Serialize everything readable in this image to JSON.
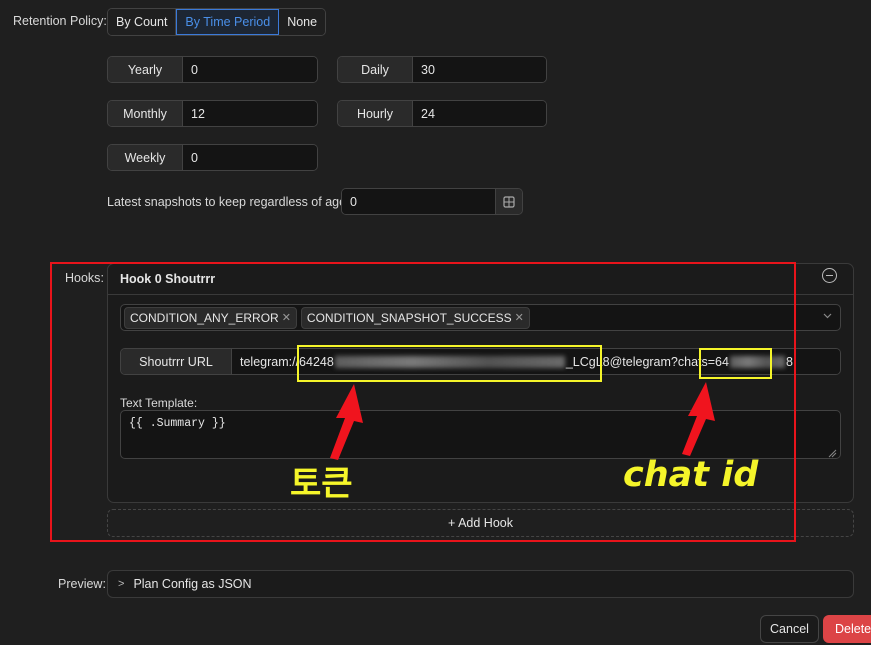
{
  "retention": {
    "label": "Retention Policy",
    "options": [
      "By Count",
      "By Time Period",
      "None"
    ],
    "selected": "By Time Period",
    "fields": {
      "yearly": {
        "label": "Yearly",
        "value": "0"
      },
      "daily": {
        "label": "Daily",
        "value": "30"
      },
      "monthly": {
        "label": "Monthly",
        "value": "12"
      },
      "hourly": {
        "label": "Hourly",
        "value": "24"
      },
      "weekly": {
        "label": "Weekly",
        "value": "0"
      }
    },
    "latest": {
      "label": "Latest snapshots to keep regardless of age",
      "value": "0"
    }
  },
  "hooks": {
    "label": "Hooks",
    "hook": {
      "title": "Hook 0 Shoutrrr",
      "conditions": [
        "CONDITION_ANY_ERROR",
        "CONDITION_SNAPSHOT_SUCCESS"
      ],
      "url_label": "Shoutrrr URL",
      "url_prefix": "telegram://64248",
      "url_mid": "_LCgL8@telegram?chats=64",
      "url_suffix": "8",
      "template_label": "Text Template:",
      "template_value": "{{ .Summary }}"
    },
    "add_label": "+ Add Hook"
  },
  "annotations": {
    "token": "토큰",
    "chat_id": "chat id",
    "highlight_color": "#f5f52a",
    "box_color": "#e8141b"
  },
  "preview": {
    "label": "Preview",
    "toggle": "Plan Config as JSON"
  },
  "actions": {
    "cancel": "Cancel",
    "delete": "Delete"
  }
}
